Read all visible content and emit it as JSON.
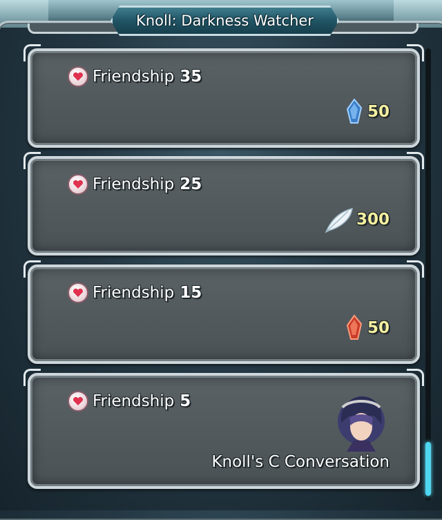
{
  "title": "Knoll: Darkness Watcher",
  "cards": [
    {
      "label": "Friendship",
      "level": "35",
      "reward_icon": "blue-orb-icon",
      "reward_amount": "50"
    },
    {
      "label": "Friendship",
      "level": "25",
      "reward_icon": "feather-icon",
      "reward_amount": "300"
    },
    {
      "label": "Friendship",
      "level": "15",
      "reward_icon": "red-orb-icon",
      "reward_amount": "50"
    },
    {
      "label": "Friendship",
      "level": "5",
      "reward_icon": "knoll-portrait",
      "reward_text": "Knoll's C Conversation"
    }
  ],
  "colors": {
    "reward_amount": "#f4efa0",
    "banner": "#215566",
    "scroll_thumb": "#4fd6f0"
  },
  "scroll": {
    "position_fraction": 0.87
  }
}
